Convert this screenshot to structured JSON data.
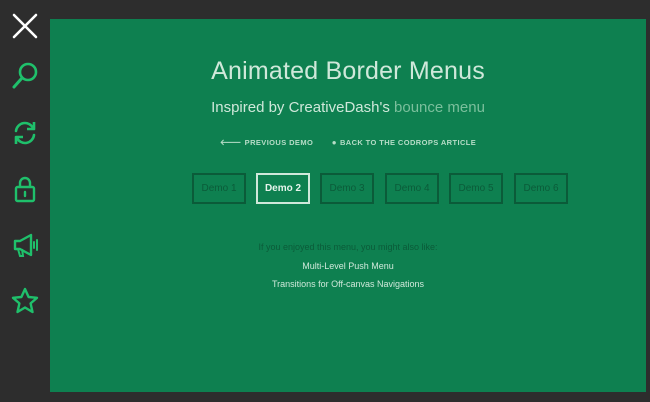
{
  "colors": {
    "background": "#2d2d2d",
    "main_green": "#0e8050",
    "icon_green": "#1fc06b",
    "dark_green": "#0b5b39",
    "light_text": "#cfe8da"
  },
  "sidebar": {
    "icons": [
      "close-icon",
      "search-icon",
      "refresh-icon",
      "lock-icon",
      "megaphone-icon",
      "star-icon"
    ]
  },
  "header": {
    "title": "Animated Border Menus",
    "subtitle_prefix": "Inspired by CreativeDash's",
    "subtitle_accent": "bounce menu"
  },
  "links": {
    "previous_glyph": "🡐",
    "previous": "PREVIOUS DEMO",
    "back_glyph": "●",
    "back": "BACK TO THE CODROPS ARTICLE"
  },
  "demos": [
    {
      "label": "Demo 1",
      "active": false
    },
    {
      "label": "Demo 2",
      "active": true
    },
    {
      "label": "Demo 3",
      "active": false
    },
    {
      "label": "Demo 4",
      "active": false
    },
    {
      "label": "Demo 5",
      "active": false
    },
    {
      "label": "Demo 6",
      "active": false
    }
  ],
  "related": {
    "intro": "If you enjoyed this menu, you might also like:",
    "items": [
      "Multi-Level Push Menu",
      "Transitions for Off-canvas Navigations"
    ]
  }
}
